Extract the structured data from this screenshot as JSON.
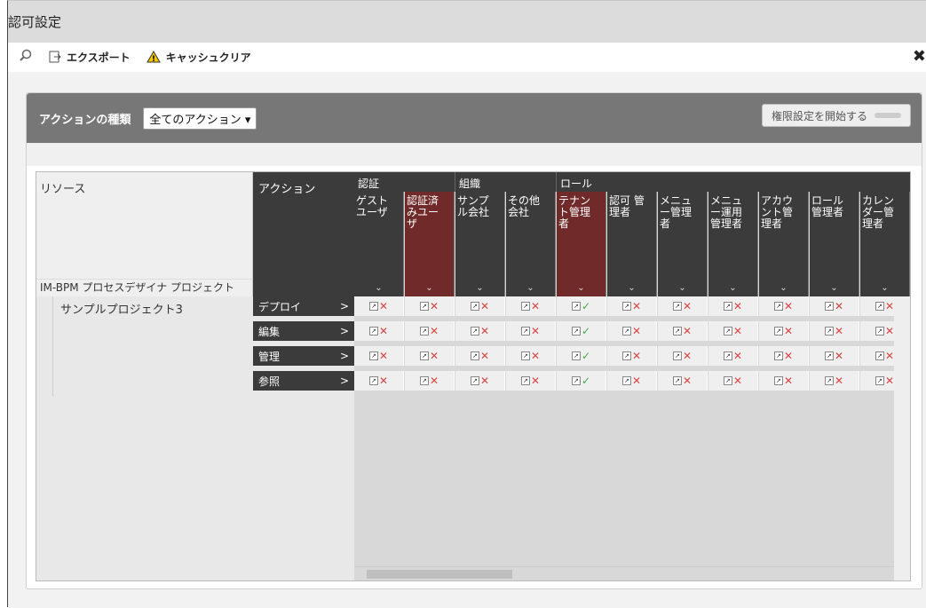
{
  "window": {
    "title": "認可設定",
    "close_glyph": "✖"
  },
  "toolbar": {
    "search_icon": "search-icon",
    "export_label": "エクスポート",
    "cache_clear_label": "キャッシュクリア"
  },
  "panel": {
    "action_type_label": "アクションの種類",
    "action_type_value": "全てのアクション ▾",
    "start_button_label": "権限設定を開始する"
  },
  "headers": {
    "resource": "リソース",
    "action": "アクション",
    "project_node": "IM-BPM プロセスデザイナ プロジェクト"
  },
  "groups": [
    {
      "label": "認証"
    },
    {
      "label": "組織"
    },
    {
      "label": "ロール"
    }
  ],
  "roles": [
    {
      "label": "ゲスト ユーザ",
      "highlight": false
    },
    {
      "label": "認証済 みユー ザ",
      "highlight": true
    },
    {
      "label": "サンプ ル会社",
      "highlight": false
    },
    {
      "label": "その他 会社",
      "highlight": false
    },
    {
      "label": "テナン ト管理 者",
      "highlight": true
    },
    {
      "label": "認可 管 理者",
      "highlight": false
    },
    {
      "label": "メニュ ー管理 者",
      "highlight": false
    },
    {
      "label": "メニュ ー運用 管理者",
      "highlight": false
    },
    {
      "label": "アカウ ント管 理者",
      "highlight": false
    },
    {
      "label": "ロール 管理者",
      "highlight": false
    },
    {
      "label": "カレン ダー管 理者",
      "highlight": false
    }
  ],
  "resource_row": {
    "label": "サンプルプロジェクト3"
  },
  "actions": [
    {
      "label": "デプロイ",
      "arrow": ">"
    },
    {
      "label": "編集",
      "arrow": ">"
    },
    {
      "label": "管理",
      "arrow": ">"
    },
    {
      "label": "参照",
      "arrow": ">"
    }
  ],
  "permissions": [
    [
      "deny",
      "deny",
      "deny",
      "deny",
      "allow",
      "deny",
      "deny",
      "deny",
      "deny",
      "deny",
      "deny"
    ],
    [
      "deny",
      "deny",
      "deny",
      "deny",
      "allow",
      "deny",
      "deny",
      "deny",
      "deny",
      "deny",
      "deny"
    ],
    [
      "deny",
      "deny",
      "deny",
      "deny",
      "allow",
      "deny",
      "deny",
      "deny",
      "deny",
      "deny",
      "deny"
    ],
    [
      "deny",
      "deny",
      "deny",
      "deny",
      "allow",
      "deny",
      "deny",
      "deny",
      "deny",
      "deny",
      "deny"
    ]
  ],
  "colors": {
    "header_dark": "#3b3b3b",
    "highlight_red": "#702a2a",
    "deny": "#dd4444",
    "allow": "#44aa44"
  }
}
